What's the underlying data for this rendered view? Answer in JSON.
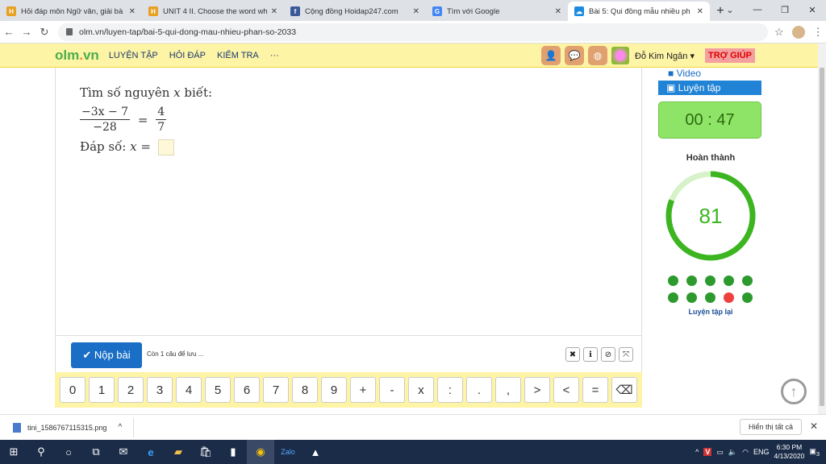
{
  "browser": {
    "tabs": [
      {
        "title": "Hỏi đáp môn Ngữ văn, giải bà",
        "icon": "H",
        "color": "#e8a020",
        "active": false
      },
      {
        "title": "UNIT 4 II. Choose the word wh",
        "icon": "H",
        "color": "#e8a020",
        "active": false
      },
      {
        "title": "Cộng đồng Hoidap247.com",
        "icon": "f",
        "color": "#3b5998",
        "active": false
      },
      {
        "title": "Tìm với Google",
        "icon": "G",
        "color": "#4285f4",
        "active": false
      },
      {
        "title": "Bài 5: Qui đồng mẫu nhiều ph",
        "icon": "☁",
        "color": "#1a8be0",
        "active": true
      }
    ],
    "new_tab": "+",
    "url": "olm.vn/luyen-tap/bai-5-qui-dong-mau-nhieu-phan-so-2033"
  },
  "site": {
    "logo_main": "olm",
    "logo_dot": ".",
    "logo_tld": "vn",
    "nav": [
      "LUYỆN TẬP",
      "HỎI ĐÁP",
      "KIỂM TRA",
      "···"
    ],
    "user_name": "Đỗ Kim Ngân",
    "help": "TRỢ GIÚP"
  },
  "question": {
    "prompt_prefix": "Tìm số nguyên ",
    "var": "x",
    "prompt_suffix": " biết:",
    "lhs_num": "−3x − 7",
    "lhs_den": "−28",
    "eq": "=",
    "rhs_num": "4",
    "rhs_den": "7",
    "answer_label": "Đáp số: ",
    "answer_var": "x",
    "answer_eq": " ="
  },
  "footer": {
    "submit": "✔ Nộp bài",
    "remaining": "Còn 1 câu để lưu ..."
  },
  "keypad": [
    "0",
    "1",
    "2",
    "3",
    "4",
    "5",
    "6",
    "7",
    "8",
    "9",
    "+",
    "-",
    "x",
    ":",
    ".",
    ",",
    ">",
    "<",
    "=",
    "⌫"
  ],
  "sidebar": {
    "video": "Video",
    "practice": "Luyện tập",
    "timer": "00 : 47",
    "done_label": "Hoàn thành",
    "score": "81",
    "score_fraction": 0.81,
    "dots": [
      "ok",
      "ok",
      "ok",
      "ok",
      "ok",
      "ok",
      "ok",
      "ok",
      "bad",
      "ok"
    ],
    "redo": "Luyện tập lại"
  },
  "download": {
    "file": "tini_1586767115315.png",
    "show_all": "Hiển thị tất cả"
  },
  "taskbar": {
    "lang": "ENG",
    "time": "6:30 PM",
    "date": "4/13/2020",
    "notif": "3"
  }
}
